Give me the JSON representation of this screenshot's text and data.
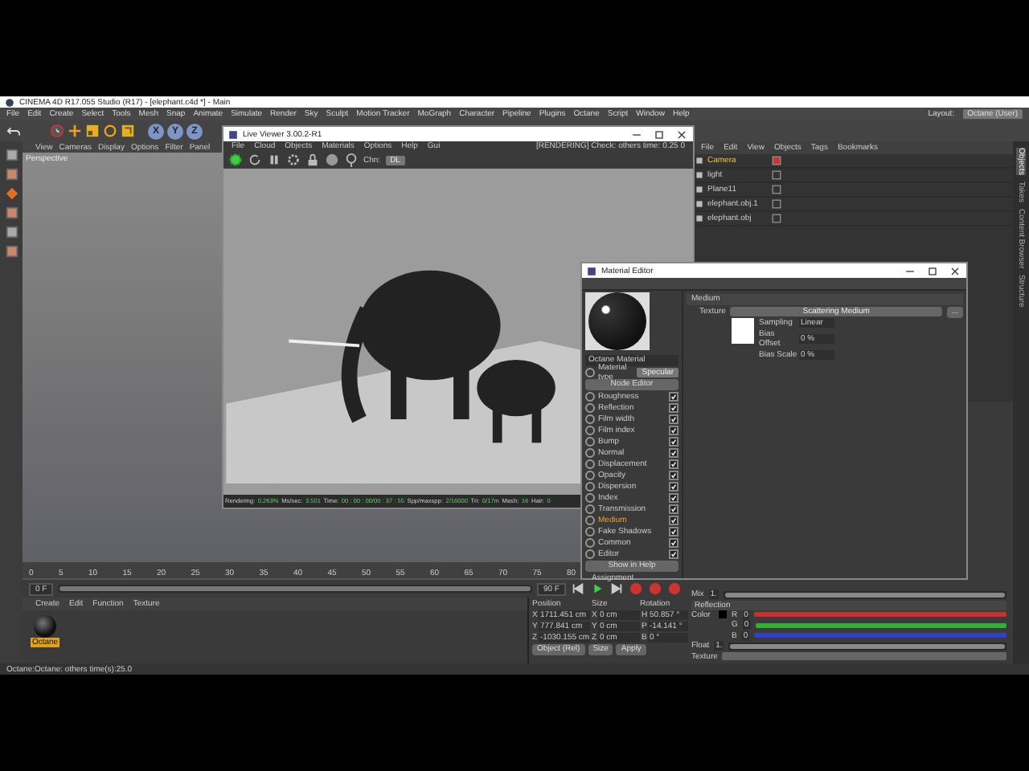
{
  "title_bar": {
    "title": "CINEMA 4D R17.055 Studio (R17) - [elephant.c4d *] - Main"
  },
  "menu_bar": {
    "items": [
      "File",
      "Edit",
      "Create",
      "Select",
      "Tools",
      "Mesh",
      "Snap",
      "Animate",
      "Simulate",
      "Render",
      "Sky",
      "Sculpt",
      "Motion Tracker",
      "MoGraph",
      "Character",
      "Pipeline",
      "Plugins",
      "Octane",
      "Script",
      "Window",
      "Help"
    ],
    "layout_label": "Layout:",
    "layout_value": "Octane (User)"
  },
  "toolbar": {
    "axis_buttons": [
      "X",
      "Y",
      "Z"
    ]
  },
  "viewport": {
    "menu": [
      "View",
      "Cameras",
      "Display",
      "Options",
      "Filter",
      "Panel"
    ],
    "label": "Perspective"
  },
  "object_manager": {
    "menu": [
      "File",
      "Edit",
      "View",
      "Objects",
      "Tags",
      "Bookmarks"
    ],
    "objects": [
      {
        "name": "Camera",
        "selected": true
      },
      {
        "name": "light",
        "selected": false
      },
      {
        "name": "Plane11",
        "selected": false
      },
      {
        "name": "elephant.obj.1",
        "selected": false
      },
      {
        "name": "elephant.obj",
        "selected": false
      }
    ]
  },
  "side_tabs": [
    {
      "label": "Objects",
      "selected": true
    },
    {
      "label": "Takes",
      "selected": false
    },
    {
      "label": "Content Browser",
      "selected": false
    },
    {
      "label": "Structure",
      "selected": false
    }
  ],
  "timeline": {
    "ticks": [
      "0",
      "5",
      "10",
      "15",
      "20",
      "25",
      "30",
      "35",
      "40",
      "45",
      "50",
      "55",
      "60",
      "65",
      "70",
      "75",
      "80"
    ],
    "start": "0 F",
    "end": "90 F",
    "range": {
      "level": 1
    }
  },
  "material_manager": {
    "menu": [
      "Create",
      "Edit",
      "Function",
      "Texture"
    ],
    "materials": [
      {
        "name": "Octane",
        "selected": true
      }
    ]
  },
  "coordinates": {
    "headers": [
      "Position",
      "Size",
      "Rotation"
    ],
    "rows": [
      {
        "axis": "X",
        "position": "1711.451 cm",
        "size_axis": "X",
        "size": "0 cm",
        "rot_axis": "H",
        "rotation": "50.857 °"
      },
      {
        "axis": "Y",
        "position": "777.841 cm",
        "size_axis": "Y",
        "size": "0 cm",
        "rot_axis": "P",
        "rotation": "-14.141 °"
      },
      {
        "axis": "Z",
        "position": "-1030.155 cm",
        "size_axis": "Z",
        "size": "0 cm",
        "rot_axis": "B",
        "rotation": "0 °"
      }
    ],
    "mode": "Object (Rel)",
    "size_mode": "Size",
    "apply": "Apply"
  },
  "attributes": {
    "mix": {
      "label": "Mix",
      "value": "1.",
      "level": 1
    },
    "section": "Reflection",
    "color_label": "Color",
    "channels": [
      {
        "label": "R",
        "value": "0",
        "color": "#c83030"
      },
      {
        "label": "G",
        "value": "0",
        "color": "#30b030"
      },
      {
        "label": "B",
        "value": "0",
        "color": "#3040c8"
      }
    ],
    "float": {
      "label": "Float",
      "value": "1.",
      "level": 1
    },
    "texture_label": "Texture"
  },
  "status_bar": {
    "text": "Octane:Octane: others time(s):25.0"
  },
  "live_viewer": {
    "title": "Live Viewer 3.00.2-R1",
    "menu": [
      "File",
      "Cloud",
      "Objects",
      "Materials",
      "Options",
      "Help",
      "Gui"
    ],
    "status": "[RENDERING] Check: others time: 0.25  0",
    "channel_label": "Chn:",
    "channel_value": "DL",
    "stats": [
      {
        "label": "Rendering:",
        "value": "0.263%"
      },
      {
        "label": "Ms/sec:",
        "value": "3.501"
      },
      {
        "label": "Time:",
        "value": "00 : 00 : 00/00 : 37 : 55"
      },
      {
        "label": "Spp/maxspp:",
        "value": "2/16000"
      },
      {
        "label": "Tri:",
        "value": "0/17m"
      },
      {
        "label": "Mesh:",
        "value": "16"
      },
      {
        "label": "Hair:",
        "value": "0"
      }
    ]
  },
  "material_editor": {
    "title": "Material Editor",
    "material_name": "Octane Material",
    "material_type_label": "Material type",
    "material_type": "Specular",
    "node_editor": "Node Editor",
    "channels": [
      {
        "name": "Roughness",
        "enabled": true,
        "selected": false
      },
      {
        "name": "Reflection",
        "enabled": true,
        "selected": false
      },
      {
        "name": "Film width",
        "enabled": true,
        "selected": false
      },
      {
        "name": "Film index",
        "enabled": true,
        "selected": false
      },
      {
        "name": "Bump",
        "enabled": true,
        "selected": false
      },
      {
        "name": "Normal",
        "enabled": true,
        "selected": false
      },
      {
        "name": "Displacement",
        "enabled": true,
        "selected": false
      },
      {
        "name": "Opacity",
        "enabled": true,
        "selected": false
      },
      {
        "name": "Dispersion",
        "enabled": true,
        "selected": false
      },
      {
        "name": "Index",
        "enabled": true,
        "selected": false
      },
      {
        "name": "Transmission",
        "enabled": true,
        "selected": false
      },
      {
        "name": "Medium",
        "enabled": true,
        "selected": true
      },
      {
        "name": "Fake Shadows",
        "enabled": true,
        "selected": false
      },
      {
        "name": "Common",
        "enabled": true,
        "selected": false
      },
      {
        "name": "Editor",
        "enabled": true,
        "selected": false
      }
    ],
    "show_in_help": "Show in Help",
    "assignment": "Assignment",
    "section": "Medium",
    "texture_label": "Texture",
    "texture_value": "Scattering Medium",
    "more": "...",
    "params": [
      {
        "label": "Sampling",
        "value": "Linear"
      },
      {
        "label": "Bias Offset",
        "value": "0 %"
      },
      {
        "label": "Bias Scale",
        "value": "0 %"
      }
    ]
  }
}
